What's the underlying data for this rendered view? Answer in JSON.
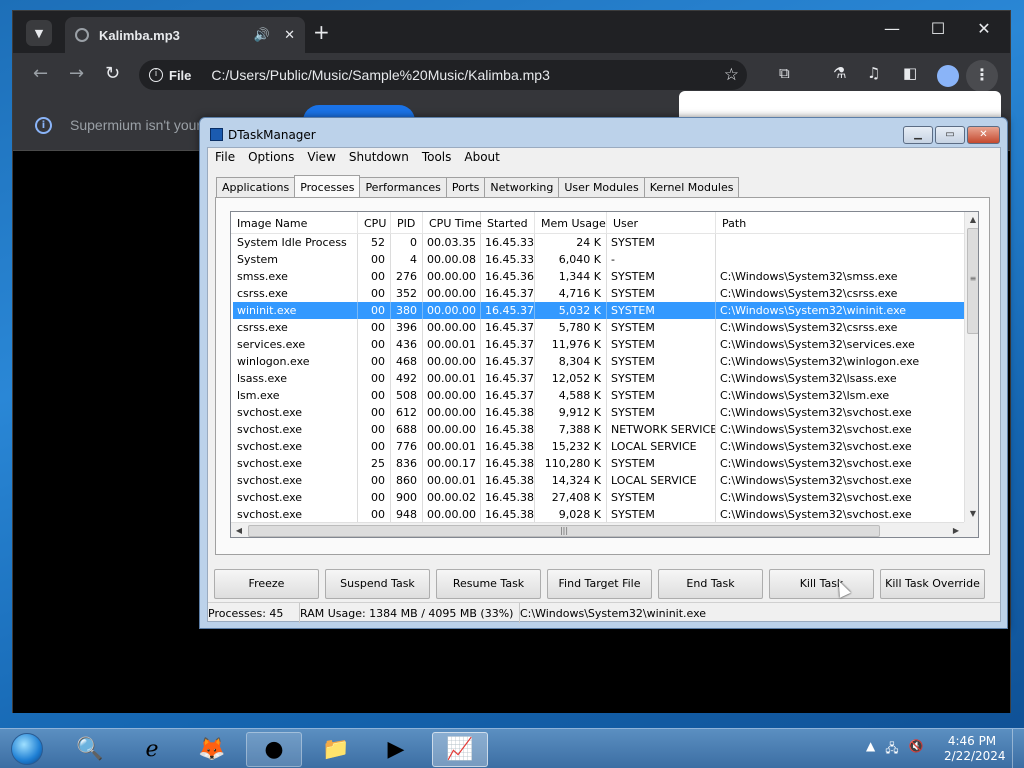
{
  "browser": {
    "tab_title": "Kalimba.mp3",
    "tab_close": "✕",
    "new_tab": "+",
    "omnibox_chip": "File",
    "url": "C:/Users/Public/Music/Sample%20Music/Kalimba.mp3",
    "infobar_message": "Supermium isn't your"
  },
  "dtm": {
    "title": "DTaskManager",
    "menu": [
      "File",
      "Options",
      "View",
      "Shutdown",
      "Tools",
      "About"
    ],
    "tabs": [
      "Applications",
      "Processes",
      "Performances",
      "Ports",
      "Networking",
      "User Modules",
      "Kernel Modules"
    ],
    "active_tab": "Processes",
    "columns": [
      "Image Name",
      "CPU",
      "PID",
      "CPU Time",
      "Started",
      "Mem Usage",
      "User",
      "Path"
    ],
    "rows": [
      [
        "System Idle Process",
        "52",
        "0",
        "00.03.35",
        "16.45.33",
        "24 K",
        "SYSTEM",
        ""
      ],
      [
        "System",
        "00",
        "4",
        "00.00.08",
        "16.45.33",
        "6,040 K",
        "-",
        ""
      ],
      [
        "smss.exe",
        "00",
        "276",
        "00.00.00",
        "16.45.36",
        "1,344 K",
        "SYSTEM",
        "C:\\Windows\\System32\\smss.exe"
      ],
      [
        "csrss.exe",
        "00",
        "352",
        "00.00.00",
        "16.45.37",
        "4,716 K",
        "SYSTEM",
        "C:\\Windows\\System32\\csrss.exe"
      ],
      [
        "wininit.exe",
        "00",
        "380",
        "00.00.00",
        "16.45.37",
        "5,032 K",
        "SYSTEM",
        "C:\\Windows\\System32\\wininit.exe"
      ],
      [
        "csrss.exe",
        "00",
        "396",
        "00.00.00",
        "16.45.37",
        "5,780 K",
        "SYSTEM",
        "C:\\Windows\\System32\\csrss.exe"
      ],
      [
        "services.exe",
        "00",
        "436",
        "00.00.01",
        "16.45.37",
        "11,976 K",
        "SYSTEM",
        "C:\\Windows\\System32\\services.exe"
      ],
      [
        "winlogon.exe",
        "00",
        "468",
        "00.00.00",
        "16.45.37",
        "8,304 K",
        "SYSTEM",
        "C:\\Windows\\System32\\winlogon.exe"
      ],
      [
        "lsass.exe",
        "00",
        "492",
        "00.00.01",
        "16.45.37",
        "12,052 K",
        "SYSTEM",
        "C:\\Windows\\System32\\lsass.exe"
      ],
      [
        "lsm.exe",
        "00",
        "508",
        "00.00.00",
        "16.45.37",
        "4,588 K",
        "SYSTEM",
        "C:\\Windows\\System32\\lsm.exe"
      ],
      [
        "svchost.exe",
        "00",
        "612",
        "00.00.00",
        "16.45.38",
        "9,912 K",
        "SYSTEM",
        "C:\\Windows\\System32\\svchost.exe"
      ],
      [
        "svchost.exe",
        "00",
        "688",
        "00.00.00",
        "16.45.38",
        "7,388 K",
        "NETWORK SERVICE",
        "C:\\Windows\\System32\\svchost.exe"
      ],
      [
        "svchost.exe",
        "00",
        "776",
        "00.00.01",
        "16.45.38",
        "15,232 K",
        "LOCAL SERVICE",
        "C:\\Windows\\System32\\svchost.exe"
      ],
      [
        "svchost.exe",
        "25",
        "836",
        "00.00.17",
        "16.45.38",
        "110,280 K",
        "SYSTEM",
        "C:\\Windows\\System32\\svchost.exe"
      ],
      [
        "svchost.exe",
        "00",
        "860",
        "00.00.01",
        "16.45.38",
        "14,324 K",
        "LOCAL SERVICE",
        "C:\\Windows\\System32\\svchost.exe"
      ],
      [
        "svchost.exe",
        "00",
        "900",
        "00.00.02",
        "16.45.38",
        "27,408 K",
        "SYSTEM",
        "C:\\Windows\\System32\\svchost.exe"
      ],
      [
        "svchost.exe",
        "00",
        "948",
        "00.00.00",
        "16.45.38",
        "9,028 K",
        "SYSTEM",
        "C:\\Windows\\System32\\svchost.exe"
      ]
    ],
    "selected_row": 4,
    "buttons": [
      "Freeze",
      "Suspend Task",
      "Resume Task",
      "Find Target File",
      "End Task",
      "Kill Task",
      "Kill Task Override"
    ],
    "status": {
      "processes": "Processes: 45",
      "ram": "RAM Usage:  1384 MB / 4095 MB (33%)",
      "path": "C:\\Windows\\System32\\wininit.exe"
    }
  },
  "taskbar": {
    "time": "4:46 PM",
    "date": "2/22/2024"
  }
}
